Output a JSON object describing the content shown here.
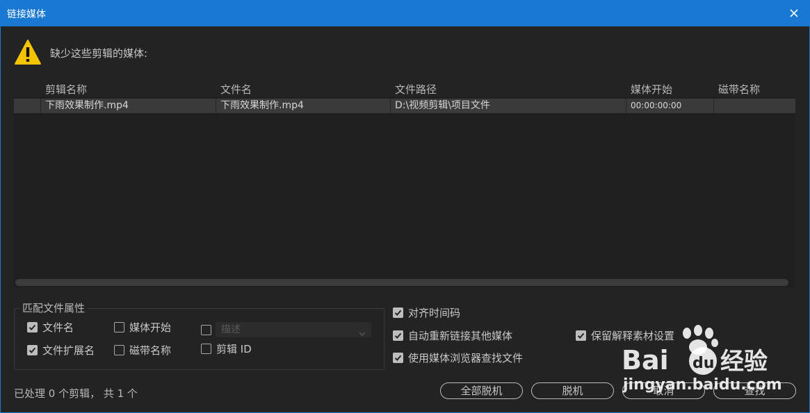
{
  "window": {
    "title": "链接媒体"
  },
  "message": "缺少这些剪辑的媒体:",
  "table": {
    "columns": [
      "剪辑名称",
      "文件名",
      "文件路径",
      "媒体开始",
      "磁带名称"
    ],
    "rows": [
      {
        "clip_name": "下雨效果制作.mp4",
        "file_name": "下雨效果制作.mp4",
        "file_path": "D:\\视频剪辑\\项目文件",
        "media_start": "00:00:00:00",
        "tape_name": ""
      }
    ]
  },
  "match": {
    "title": "匹配文件属性",
    "file_name": {
      "label": "文件名",
      "checked": true
    },
    "media_start": {
      "label": "媒体开始",
      "checked": false
    },
    "description": {
      "checked": false,
      "placeholder": "描述"
    },
    "file_extension": {
      "label": "文件扩展名",
      "checked": true
    },
    "tape_name": {
      "label": "磁带名称",
      "checked": false
    },
    "clip_id": {
      "label": "剪辑 ID",
      "checked": false
    }
  },
  "options": {
    "align_timecode": {
      "label": "对齐时间码",
      "checked": true
    },
    "relink_others": {
      "label": "自动重新链接其他媒体",
      "checked": true
    },
    "use_browser": {
      "label": "使用媒体浏览器查找文件",
      "checked": true
    },
    "preserve_interpret": {
      "label": "保留解释素材设置",
      "checked": true
    }
  },
  "status": "已处理 0 个剪辑， 共 1 个",
  "buttons": {
    "offline_all": "全部脱机",
    "offline": "脱机",
    "cancel": "取消",
    "find": "查找"
  },
  "watermark": {
    "text": "jingyan.baidu.com"
  },
  "colors": {
    "titlebar": "#1878d2",
    "warning": "#f5c400",
    "background": "#232323"
  }
}
